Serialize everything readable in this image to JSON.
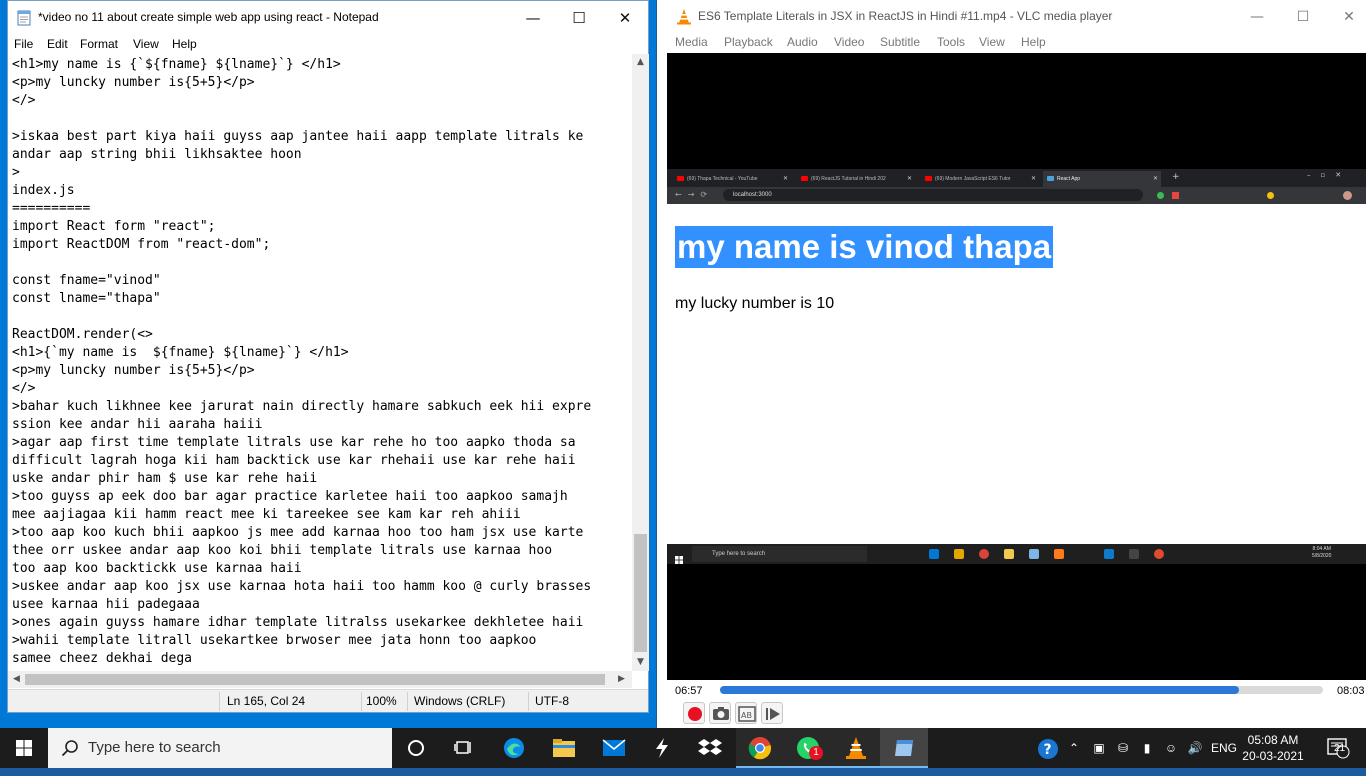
{
  "notepad": {
    "title": "*video no 11 about create simple web app using react - Notepad",
    "menu": [
      "File",
      "Edit",
      "Format",
      "View",
      "Help"
    ],
    "text": "<h1>my name is {`${fname} ${lname}`} </h1>\n<p>my luncky number is{5+5}</p>\n</>\n\n>iskaa best part kiya haii guyss aap jantee haii aapp template litrals ke\nandar aap string bhii likhsaktee hoon\n>\nindex.js\n==========\nimport React form \"react\";\nimport ReactDOM from \"react-dom\";\n\nconst fname=\"vinod\"\nconst lname=\"thapa\"\n\nReactDOM.render(<>\n<h1>{`my name is  ${fname} ${lname}`} </h1>\n<p>my luncky number is{5+5}</p>\n</>\n>bahar kuch likhnee kee jarurat nain directly hamare sabkuch eek hii expre\nssion kee andar hii aaraha haiii\n>agar aap first time template litrals use kar rehe ho too aapko thoda sa\ndifficult lagrah hoga kii ham backtick use kar rhehaii use kar rehe haii\nuske andar phir ham $ use kar rehe haii\n>too guyss ap eek doo bar agar practice karletee haii too aapkoo samajh\nmee aajiagaa kii hamm react mee ki tareekee see kam kar reh ahiii\n>too aap koo kuch bhii aapkoo js mee add karnaa hoo too ham jsx use karte\nthee orr uskee andar aap koo koi bhii template litrals use karnaa hoo\ntoo aap koo backtickk use karnaa haii\n>uskee andar aap koo jsx use karnaa hota haii too hamm koo @ curly brasses\nusee karnaa hii padegaaa\n>ones again guyss hamare idhar template litralss usekarkee dekhletee haii\n>wahii template litrall usekartkee brwoser mee jata honn too aapkoo\nsamee cheez dekhai dega",
    "status": {
      "position": "Ln 165, Col 24",
      "zoom": "100%",
      "line_ending": "Windows (CRLF)",
      "encoding": "UTF-8"
    }
  },
  "vlc": {
    "title": "ES6 Template Literals in JSX in ReactJS in Hindi #11.mp4 - VLC media player",
    "menu": [
      "Media",
      "Playback",
      "Audio",
      "Video",
      "Subtitle",
      "Tools",
      "View",
      "Help"
    ],
    "time_elapsed": "06:57",
    "time_total": "08:03",
    "progress": 0.86,
    "video": {
      "tabs": [
        "(69) Thapa Technical - YouTube",
        "(69) ReactJS Tutorial in Hindi 202",
        "(69) Modern JavaScript ES6 Tutor",
        "React App"
      ],
      "url": "localhost:3000",
      "page_heading": "my name is vinod thapa",
      "page_paragraph": "my lucky number is 10",
      "taskbar_search": "Type here to search",
      "clock_time": "8:04 AM",
      "clock_date": "5/8/2020"
    }
  },
  "taskbar": {
    "search_placeholder": "Type here to search",
    "language": "ENG",
    "time": "05:08 AM",
    "date": "20-03-2021",
    "notification_count": "21",
    "whatsapp_badge": "1"
  },
  "colors": {
    "selection": "#3390ff",
    "vlc_progress": "#2b78d8",
    "taskbar": "#1c1c1c",
    "accent": "#0078d7"
  }
}
